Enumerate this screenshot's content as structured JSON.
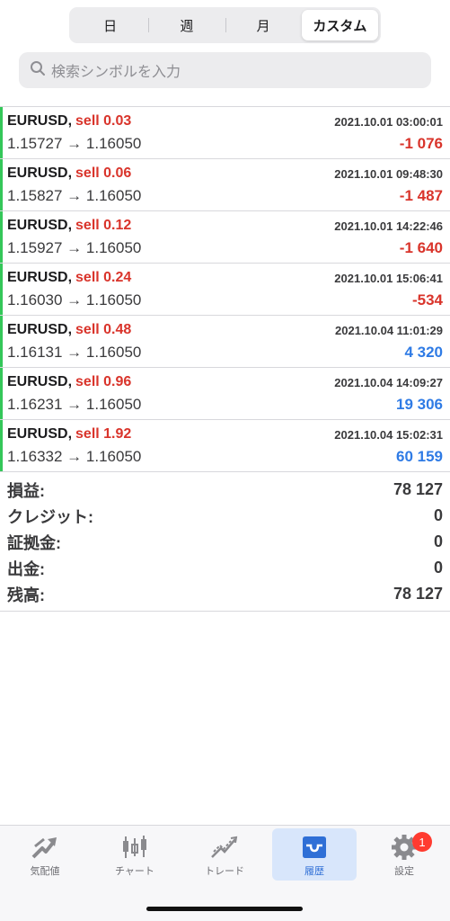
{
  "segments": {
    "items": [
      "日",
      "週",
      "月",
      "カスタム"
    ],
    "selected": "カスタム"
  },
  "search": {
    "placeholder": "検索シンボルを入力",
    "icon": "search-icon"
  },
  "trades": [
    {
      "symbol": "EURUSD,",
      "side": "sell 0.03",
      "time": "2021.10.01 03:00:01",
      "prices": "1.15727 → 1.16050",
      "profit": "-1 076",
      "positive": false
    },
    {
      "symbol": "EURUSD,",
      "side": "sell 0.06",
      "time": "2021.10.01 09:48:30",
      "prices": "1.15827 → 1.16050",
      "profit": "-1 487",
      "positive": false
    },
    {
      "symbol": "EURUSD,",
      "side": "sell 0.12",
      "time": "2021.10.01 14:22:46",
      "prices": "1.15927 → 1.16050",
      "profit": "-1 640",
      "positive": false
    },
    {
      "symbol": "EURUSD,",
      "side": "sell 0.24",
      "time": "2021.10.01 15:06:41",
      "prices": "1.16030 → 1.16050",
      "profit": "-534",
      "positive": false
    },
    {
      "symbol": "EURUSD,",
      "side": "sell 0.48",
      "time": "2021.10.04 11:01:29",
      "prices": "1.16131 → 1.16050",
      "profit": "4 320",
      "positive": true
    },
    {
      "symbol": "EURUSD,",
      "side": "sell 0.96",
      "time": "2021.10.04 14:09:27",
      "prices": "1.16231 → 1.16050",
      "profit": "19 306",
      "positive": true
    },
    {
      "symbol": "EURUSD,",
      "side": "sell 1.92",
      "time": "2021.10.04 15:02:31",
      "prices": "1.16332 → 1.16050",
      "profit": "60 159",
      "positive": true
    }
  ],
  "summary": [
    {
      "label": "損益:",
      "value": "78 127"
    },
    {
      "label": "クレジット:",
      "value": "0"
    },
    {
      "label": "証拠金:",
      "value": "0"
    },
    {
      "label": "出金:",
      "value": "0"
    },
    {
      "label": "残高:",
      "value": "78 127"
    }
  ],
  "tabbar": {
    "tabs": [
      {
        "label": "気配値",
        "icon": "quotes-icon"
      },
      {
        "label": "チャート",
        "icon": "candlestick-chart-icon"
      },
      {
        "label": "トレード",
        "icon": "trade-icon"
      },
      {
        "label": "履歴",
        "icon": "history-inbox-icon"
      },
      {
        "label": "設定",
        "icon": "gear-icon"
      }
    ],
    "active": "履歴",
    "settings_badge": "1"
  },
  "colors": {
    "accent": "#2f6fd6",
    "loss": "#d9342b",
    "gain": "#2f7be5",
    "buy_bar": "#34c759"
  }
}
